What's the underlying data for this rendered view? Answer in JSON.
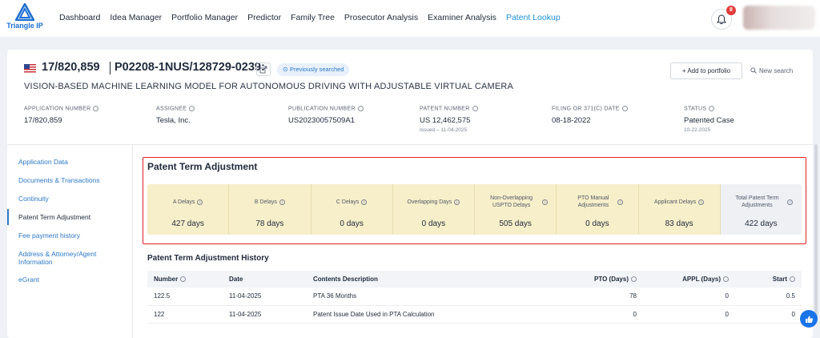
{
  "brand": {
    "logo_text": "Triangle IP"
  },
  "nav": {
    "items": [
      "Dashboard",
      "Idea Manager",
      "Portfolio Manager",
      "Predictor",
      "Family Tree",
      "Prosecutor Analysis",
      "Examiner Analysis",
      "Patent Lookup"
    ],
    "active": "Patent Lookup"
  },
  "notifications": {
    "count": "8",
    "icon": "bell-icon"
  },
  "header": {
    "application_number": "17/820,859",
    "docket": "P02208-1NUS/128729-0239:",
    "badge": "Previously searched",
    "add_to_portfolio": "+ Add to portfolio",
    "new_search": "New search",
    "title": "VISION-BASED MACHINE LEARNING MODEL FOR AUTONOMOUS DRIVING WITH ADJUSTABLE VIRTUAL CAMERA"
  },
  "meta": {
    "app_label": "APPLICATION NUMBER",
    "app_value": "17/820,859",
    "assignee_label": "ASSIGNEE",
    "assignee_value": "Tesla, Inc.",
    "pub_label": "PUBLICATION NUMBER",
    "pub_value": "US20230057509A1",
    "patent_label": "PATENT NUMBER",
    "patent_value": "US 12,462,575",
    "patent_sub": "Issued – 11-04-2025",
    "filing_label": "FILING OR 371(C) DATE",
    "filing_value": "08-18-2022",
    "status_label": "STATUS",
    "status_value": "Patented Case",
    "status_sub": "10-22-2025"
  },
  "sidebar": {
    "items": [
      "Application Data",
      "Documents & Transactions",
      "Continuity",
      "Patent Term Adjustment",
      "Fee payment history",
      "Address & Attorney/Agent",
      "Information",
      "eGrant"
    ],
    "active": "Patent Term Adjustment"
  },
  "pta": {
    "title": "Patent Term Adjustment",
    "cells": [
      {
        "label": "A Delays",
        "value": "427 days"
      },
      {
        "label": "B Delays",
        "value": "78 days"
      },
      {
        "label": "C Delays",
        "value": "0 days"
      },
      {
        "label": "Overlapping Days",
        "value": "0 days"
      },
      {
        "label": "Non-Overlapping USPTO Delays",
        "value": "505 days"
      },
      {
        "label": "PTO Manual Adjustments",
        "value": "0 days"
      },
      {
        "label": "Applicant Delays",
        "value": "83 days"
      },
      {
        "label": "Total Patent Term Adjustments",
        "value": "422 days"
      }
    ]
  },
  "history": {
    "title": "Patent Term Adjustment History",
    "columns": [
      "Number",
      "Date",
      "Contents Description",
      "PTO (Days)",
      "APPL (Days)",
      "Start"
    ],
    "rows": [
      [
        "122.5",
        "11-04-2025",
        "PTA 36 Months",
        "78",
        "0",
        "0.5"
      ],
      [
        "122",
        "11-04-2025",
        "Patent Issue Date Used in PTA Calculation",
        "0",
        "0",
        "0"
      ]
    ]
  },
  "colors": {
    "accent": "#1f8fd6",
    "highlight_border": "#e02020",
    "pta_bg": "#f7efc9"
  }
}
